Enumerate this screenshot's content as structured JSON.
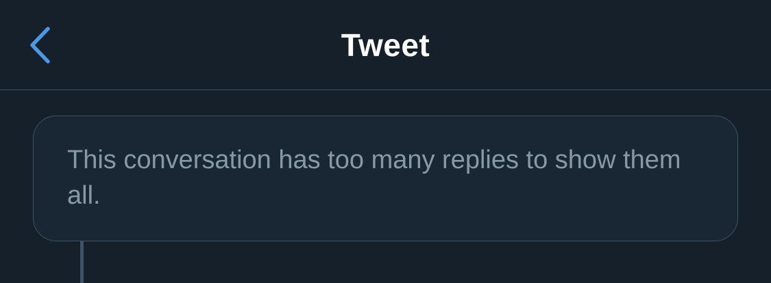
{
  "header": {
    "title": "Tweet",
    "back_icon": "chevron-left-icon",
    "back_icon_color": "#4a99e9"
  },
  "notice": {
    "text": "This conversation has too many replies to show them all."
  },
  "colors": {
    "background": "#15202b",
    "card_background": "#192734",
    "border": "#3d5466",
    "secondary_text": "#8899a6",
    "title_text": "#ffffff",
    "accent": "#4a99e9"
  }
}
